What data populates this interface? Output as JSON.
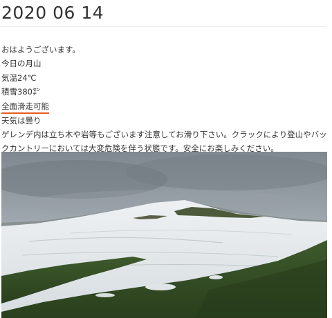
{
  "post": {
    "title": "2020 06 14",
    "lines": [
      "おはようございます。",
      "今日の月山",
      "気温24℃",
      "積雪380㌢",
      "全面滑走可能",
      "天気は曇り",
      "ゲレンデ内は立ち木や岩等もございます注意してお滑り下さい。クラックにより登山やバックカントリーにおいては大変危険を伴う状態です。安全にお楽しみください。"
    ],
    "highlight_color": "#e85a1e"
  }
}
